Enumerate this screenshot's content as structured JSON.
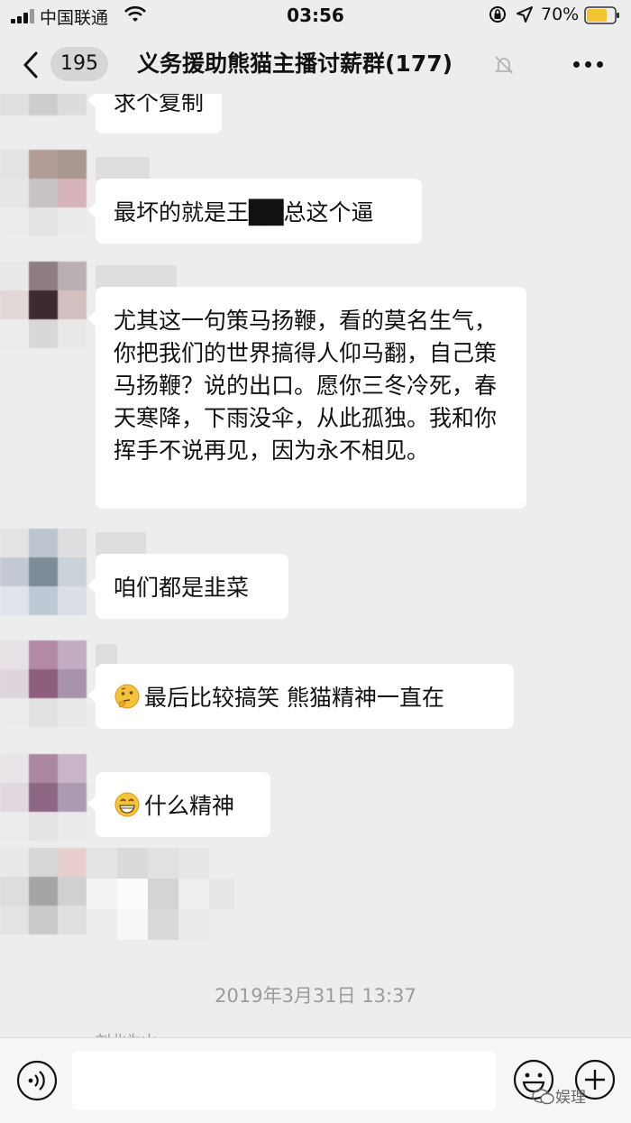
{
  "status_bar": {
    "carrier": "中国联通",
    "time": "03:56",
    "battery": "70%"
  },
  "nav": {
    "unread_count": "195",
    "title": "义务援助熊猫主播讨薪群(177)"
  },
  "messages": [
    {
      "text": "求个复制"
    },
    {
      "text": "最坏的就是王██总这个逼"
    },
    {
      "text": "尤其这一句策马扬鞭，看的莫名生气，你把我们的世界搞得人仰马翻，自己策马扬鞭？说的出口。愿你三冬冷死，春天寒降，下雨没伞，从此孤独。我和你挥手不说再见，因为永不相见。"
    },
    {
      "text": "咱们都是韭菜"
    },
    {
      "emoji": "thinking-face-icon",
      "text": "最后比较搞笑 熊猫精神一直在"
    },
    {
      "emoji": "grinning-face-icon",
      "text": "什么精神"
    }
  ],
  "timestamp": "2019年3月31日 13:37",
  "partial_sender": "刘北为山",
  "input": {
    "value": ""
  },
  "watermark": "娱理",
  "colors": {
    "background": "#ededed",
    "bubble": "#ffffff",
    "timestamp": "#9b9b9b"
  }
}
